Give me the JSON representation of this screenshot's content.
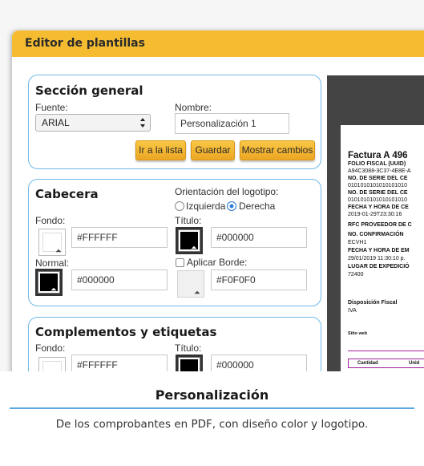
{
  "window": {
    "title": "Editor de plantillas"
  },
  "general": {
    "title": "Sección general",
    "font_label": "Fuente:",
    "font_value": "ARIAL",
    "name_label": "Nombre:",
    "name_value": "Personalización 1",
    "buttons": {
      "list": "Ir a la lista",
      "save": "Guardar",
      "show_changes": "Mostrar cambios"
    }
  },
  "cabecera": {
    "title": "Cabecera",
    "logo_orientation_label": "Orientación del logotipo:",
    "orientation_options": [
      "Izquierda",
      "Derecha"
    ],
    "orientation_selected": "Derecha",
    "fondo_label": "Fondo:",
    "fondo_value": "#FFFFFF",
    "titulo_label": "Título:",
    "titulo_value": "#000000",
    "normal_label": "Normal:",
    "normal_value": "#000000",
    "border_label": "Aplicar Borde:",
    "border_checked": false,
    "border_value": "#F0F0F0"
  },
  "complementos": {
    "title": "Complementos y etiquetas",
    "fondo_label": "Fondo:",
    "fondo_value": "#FFFFFF",
    "titulo_label": "Título:",
    "titulo_value": "#000000"
  },
  "preview": {
    "heading": "Factura A 496",
    "lines": [
      "FOLIO FISCAL (UUID)",
      "A94C3088-3C37-4E8E-A",
      "NO. DE SERIE DEL CE",
      "0101010101010101010",
      "NO. DE SERIE DEL CE",
      "0101010101010101010",
      "FECHA Y HORA DE CE",
      "2019-01-29T23:30:16",
      "RFC PROVEEDOR DE C",
      "NO. CONFIRMACIÓN",
      "ECVH1",
      "FECHA Y HORA DE EM",
      "29/01/2019 11:30:10 p.",
      "LUGAR DE EXPEDICIÓ",
      "72400"
    ],
    "disposicion_label": "Disposición Fiscal",
    "disposicion_value": "IVA",
    "sitio_label": "Sitio web",
    "table_headers": [
      "Cantidad",
      "Unid"
    ]
  },
  "caption": {
    "title": "Personalización",
    "text": "De los comprobantes en PDF, con diseño color y logotipo."
  },
  "colors": {
    "title_bar": "#f5bc32",
    "panel_border": "#6fb9e8",
    "button": "#eca624",
    "caption_rule": "#5aa8df",
    "preview_bg": "#444444",
    "table_border": "#a0229a"
  }
}
